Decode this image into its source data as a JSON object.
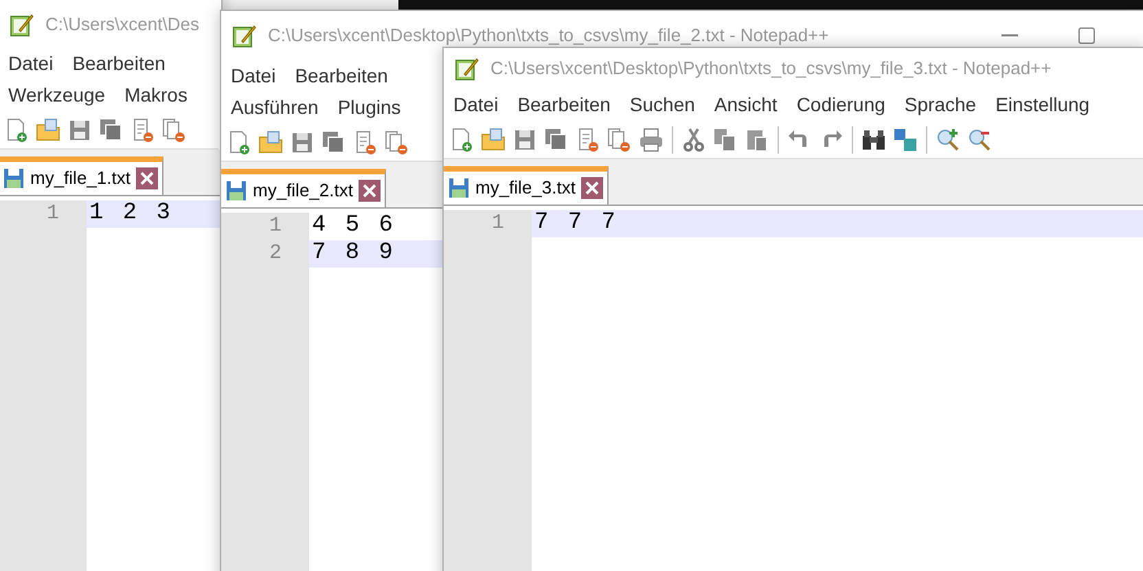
{
  "windows": [
    {
      "title": "C:\\Users\\xcent\\Des",
      "menu_rows": [
        [
          "Datei",
          "Bearbeiten"
        ],
        [
          "Werkzeuge",
          "Makros"
        ]
      ],
      "tab": {
        "label": "my_file_1.txt"
      },
      "lines": [
        {
          "number": "1",
          "text": "1 2 3",
          "current": true
        }
      ]
    },
    {
      "title": "C:\\Users\\xcent\\Desktop\\Python\\txts_to_csvs\\my_file_2.txt - Notepad++",
      "menu_rows": [
        [
          "Datei",
          "Bearbeiten"
        ],
        [
          "Ausführen",
          "Plugins"
        ]
      ],
      "tab": {
        "label": "my_file_2.txt"
      },
      "lines": [
        {
          "number": "1",
          "text": "4 5 6",
          "current": false
        },
        {
          "number": "2",
          "text": "7 8 9",
          "current": true
        }
      ]
    },
    {
      "title": "C:\\Users\\xcent\\Desktop\\Python\\txts_to_csvs\\my_file_3.txt - Notepad++",
      "menu_rows": [
        [
          "Datei",
          "Bearbeiten",
          "Suchen",
          "Ansicht",
          "Codierung",
          "Sprache",
          "Einstellung"
        ]
      ],
      "tab": {
        "label": "my_file_3.txt"
      },
      "lines": [
        {
          "number": "1",
          "text": "7 7 7",
          "current": true
        }
      ]
    }
  ]
}
